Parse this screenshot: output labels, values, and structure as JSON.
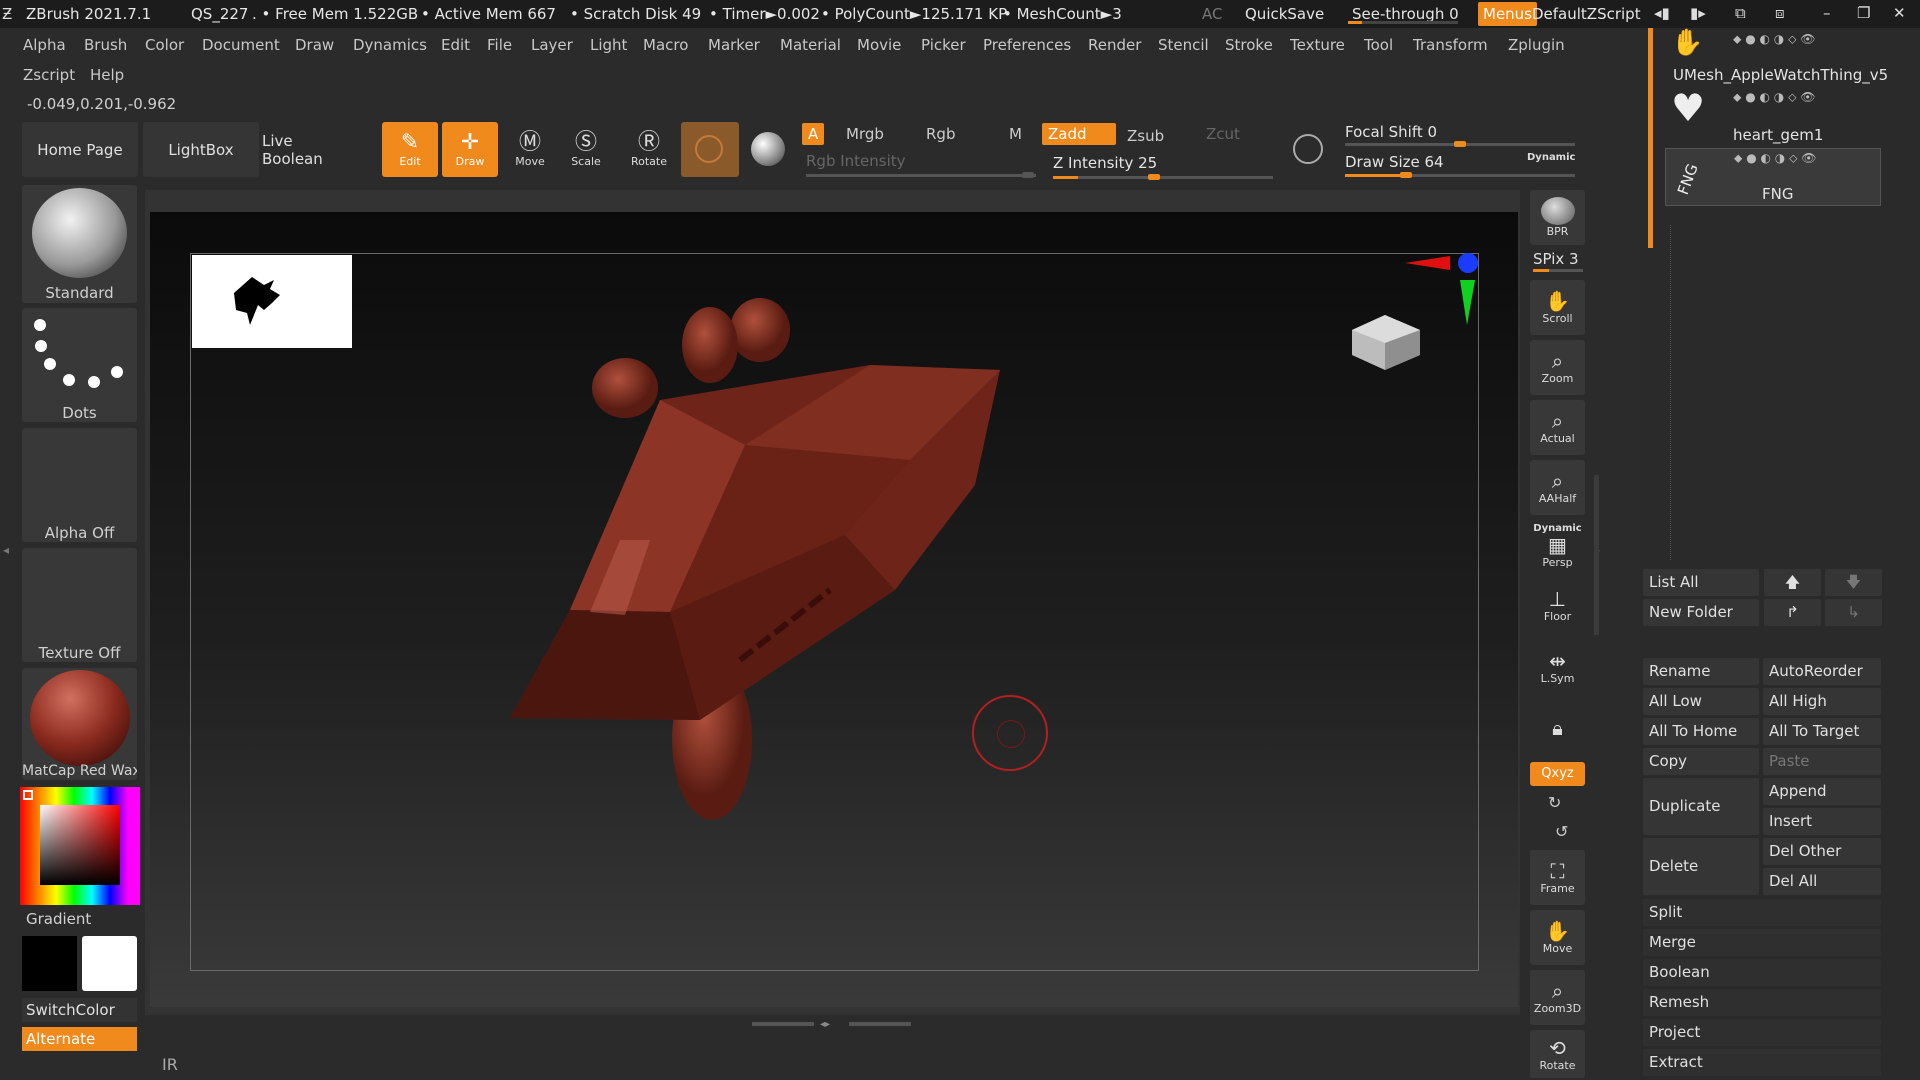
{
  "titlebar": {
    "app": "ZBrush 2021.7.1",
    "doc": "QS_227",
    "free_mem": ". • Free Mem 1.522GB",
    "active_mem": "• Active Mem 667",
    "scratch": "• Scratch Disk 49",
    "timer": "• Timer►0.002",
    "polycount": "• PolyCount►125.171 KP",
    "meshcount": "• MeshCount►3",
    "ac": "AC",
    "quicksave": "QuickSave",
    "see_through": "See-through",
    "see_through_value": "0",
    "menus": "Menus",
    "default_zscript": "DefaultZScript"
  },
  "menubar": {
    "row1": [
      "Alpha",
      "Brush",
      "Color",
      "Document",
      "Draw",
      "Dynamics",
      "Edit",
      "File",
      "Layer",
      "Light",
      "Macro",
      "Marker",
      "Material",
      "Movie",
      "Picker",
      "Preferences",
      "Render",
      "Stencil",
      "Stroke",
      "Texture",
      "Tool",
      "Transform",
      "Zplugin"
    ],
    "row2": [
      "Zscript",
      "Help"
    ],
    "coords": "-0.049,0.201,-0.962"
  },
  "shelf": {
    "home_page": "Home Page",
    "lightbox": "LightBox",
    "live_boolean": "Live Boolean",
    "edit": "Edit",
    "draw": "Draw",
    "move": "Move",
    "scale": "Scale",
    "rotate": "Rotate",
    "a": "A",
    "mrgb": "Mrgb",
    "rgb": "Rgb",
    "m": "M",
    "zadd": "Zadd",
    "zsub": "Zsub",
    "zcut": "Zcut",
    "rgb_intensity": "Rgb Intensity",
    "z_intensity": "Z Intensity 25",
    "focal_shift": "Focal Shift 0",
    "draw_size": "Draw Size 64",
    "dynamic": "Dynamic",
    "z_intensity_level": 0.25,
    "draw_size_level": 0.5
  },
  "left_panel": {
    "brush": "Standard",
    "stroke": "Dots",
    "alpha": "Alpha Off",
    "texture": "Texture Off",
    "material": "MatCap Red Wax",
    "gradient": "Gradient",
    "switch_color": "SwitchColor",
    "alternate": "Alternate"
  },
  "right_tools": {
    "bpr": "BPR",
    "spix": "SPix 3",
    "scroll": "Scroll",
    "zoom": "Zoom",
    "actual": "Actual",
    "aahalf": "AAHalf",
    "dynamic": "Dynamic",
    "persp": "Persp",
    "floor": "Floor",
    "lsym": "L.Sym",
    "xyz": "Qxyz",
    "frame": "Frame",
    "move": "Move",
    "zoom3d": "Zoom3D",
    "rotate": "Rotate"
  },
  "subtools": [
    {
      "name": "UMesh_AppleWatchThing_v5"
    },
    {
      "name": "heart_gem1"
    },
    {
      "name": "FNG"
    }
  ],
  "subtool_buttons": {
    "list_all": "List All",
    "new_folder": "New Folder",
    "rename": "Rename",
    "autoreorder": "AutoReorder",
    "all_low": "All Low",
    "all_high": "All High",
    "all_to_home": "All To Home",
    "all_to_target": "All To Target",
    "copy": "Copy",
    "paste": "Paste",
    "duplicate": "Duplicate",
    "append": "Append",
    "insert": "Insert",
    "delete": "Delete",
    "del_other": "Del Other",
    "del_all": "Del All",
    "split": "Split",
    "merge": "Merge",
    "boolean": "Boolean",
    "remesh": "Remesh",
    "project": "Project",
    "extract": "Extract"
  },
  "status": {
    "corner": "IR"
  },
  "colors": {
    "accent": "#f08a1c",
    "mesh": "#7a2a1c",
    "background": "#2b2b2b"
  }
}
